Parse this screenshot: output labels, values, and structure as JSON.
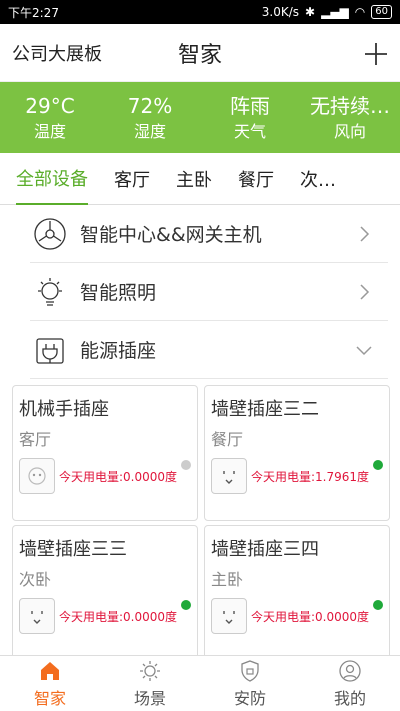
{
  "status": {
    "time": "下午2:27",
    "speed": "3.0K/s",
    "battery": "60"
  },
  "header": {
    "company": "公司大展板",
    "title": "智家",
    "add_icon": "plus-icon"
  },
  "weather": [
    {
      "value": "29°C",
      "label": "温度"
    },
    {
      "value": "72%",
      "label": "湿度"
    },
    {
      "value": "阵雨",
      "label": "天气"
    },
    {
      "value": "无持续风向",
      "label": "风向"
    }
  ],
  "tabs": [
    "全部设备",
    "客厅",
    "主卧",
    "餐厅",
    "次…"
  ],
  "categories": [
    {
      "label": "智能中心&&网关主机",
      "icon": "hub-icon"
    },
    {
      "label": "智能照明",
      "icon": "bulb-icon"
    },
    {
      "label": "能源插座",
      "icon": "plug-icon"
    }
  ],
  "devices": [
    {
      "name": "机械手插座",
      "room": "客厅",
      "power": "今天用电量:0.0000度",
      "online": false,
      "dot_color": "#cccccc"
    },
    {
      "name": "墙壁插座三二",
      "room": "餐厅",
      "power": "今天用电量:1.7961度",
      "online": true,
      "dot_color": "#1fa93a"
    },
    {
      "name": "墙壁插座三三",
      "room": "次卧",
      "power": "今天用电量:0.0000度",
      "online": true,
      "dot_color": "#1fa93a"
    },
    {
      "name": "墙壁插座三四",
      "room": "主卧",
      "power": "今天用电量:0.0000度",
      "online": true,
      "dot_color": "#1fa93a"
    }
  ],
  "bottom_nav": [
    {
      "label": "智家",
      "icon": "home-icon",
      "active": true
    },
    {
      "label": "场景",
      "icon": "scene-icon",
      "active": false
    },
    {
      "label": "安防",
      "icon": "security-icon",
      "active": false
    },
    {
      "label": "我的",
      "icon": "profile-icon",
      "active": false
    }
  ],
  "colors": {
    "accent": "#7cc242",
    "active_tab": "#5aad2a",
    "nav_active": "#f36d1f",
    "power_text": "#e0163b"
  }
}
